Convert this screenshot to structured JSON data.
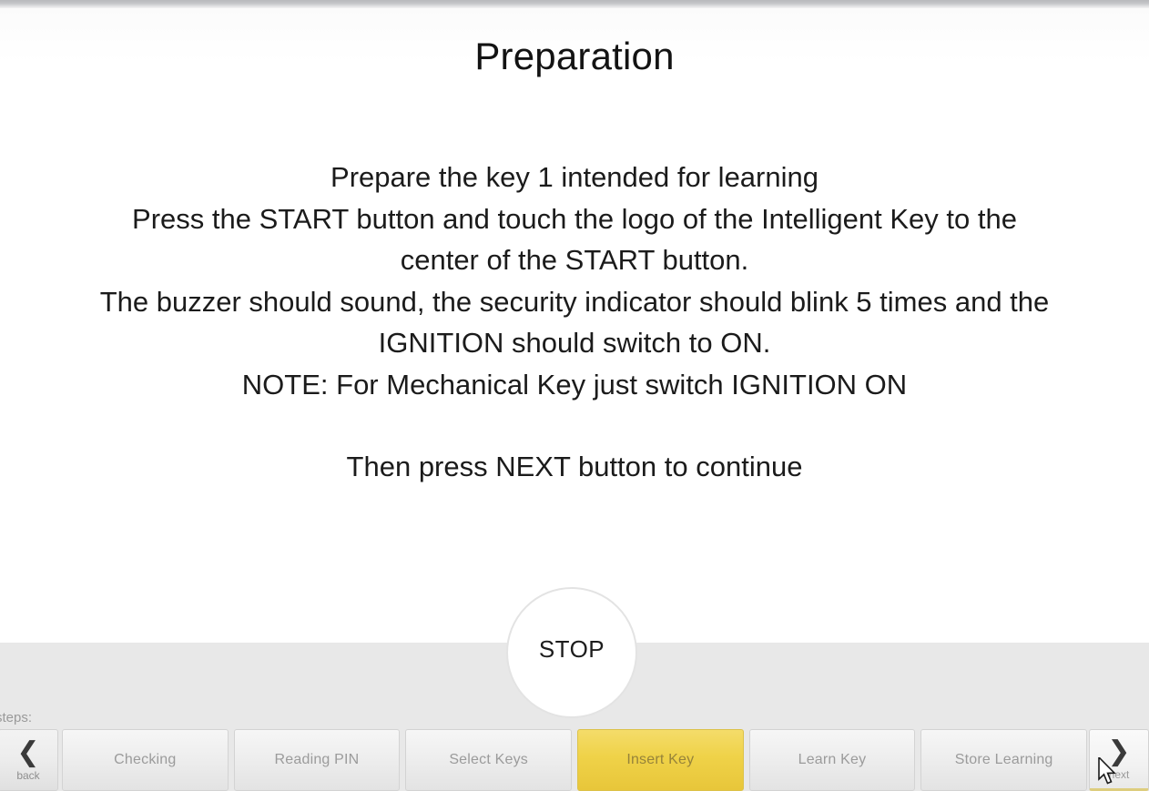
{
  "window": {
    "title": "Preparation"
  },
  "page": {
    "title": "Preparation",
    "instructions": {
      "line1": "Prepare the key 1 intended for learning",
      "line2": "Press the START button and touch the logo of the Intelligent Key to the",
      "line3": "center of the START button.",
      "line4": "The buzzer should sound, the security indicator should blink 5 times and the",
      "line5": "IGNITION should switch to ON.",
      "line6": "NOTE: For Mechanical Key just switch IGNITION ON",
      "line7": "Then press NEXT button to continue"
    }
  },
  "stop_button": {
    "label": "STOP"
  },
  "footer": {
    "steps_label": "steps:",
    "back_button": {
      "icon": "chevron-left-icon",
      "label": "back"
    },
    "next_button": {
      "icon": "chevron-right-icon",
      "label": "next"
    },
    "steps": [
      {
        "label": "Checking",
        "active": false
      },
      {
        "label": "Reading PIN",
        "active": false
      },
      {
        "label": "Select Keys",
        "active": false
      },
      {
        "label": "Insert Key",
        "active": true
      },
      {
        "label": "Learn Key",
        "active": false
      },
      {
        "label": "Store Learning",
        "active": false
      }
    ]
  },
  "colors": {
    "accent_yellow": "#EFD248",
    "footer_gray": "#E8E8E8",
    "step_text": "#9B9B9B",
    "active_step_text": "#96833A",
    "body_text": "#1B1B1B"
  },
  "cursor": {
    "icon": "mouse-pointer-icon"
  }
}
